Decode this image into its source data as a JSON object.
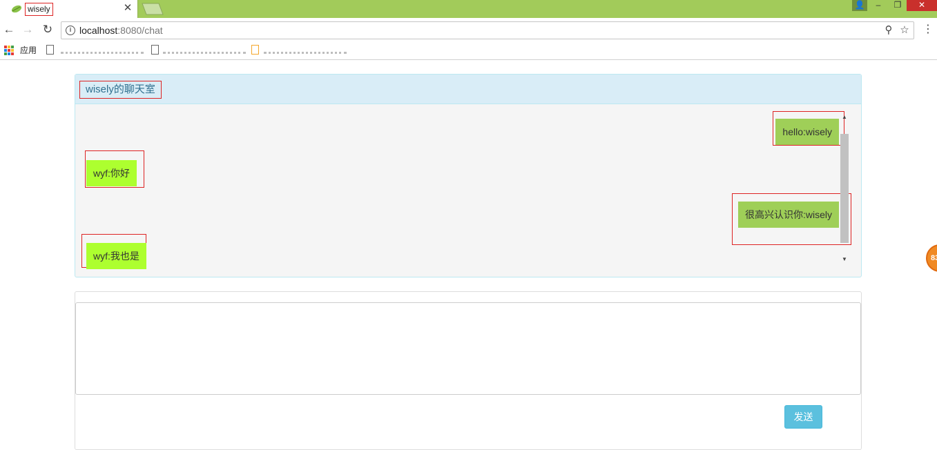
{
  "browser": {
    "tab_title": "wisely",
    "tab_close": "✕",
    "window_controls": {
      "user": "👤",
      "minimize": "–",
      "maximize": "❐",
      "close": "✕"
    },
    "url_host": "localhost",
    "url_rest": ":8080/chat",
    "icons": {
      "back": "arrow-left-icon",
      "forward": "arrow-right-icon",
      "reload": "reload-icon",
      "info": "info-icon",
      "pin": "pin-icon",
      "star": "star-icon",
      "menu": "menu-icon"
    },
    "bookmarks": {
      "apps_label": "应用"
    }
  },
  "chat": {
    "title": "wisely的聊天室",
    "messages": [
      {
        "text": "hello:wisely",
        "side": "right",
        "color": "#9fcf58"
      },
      {
        "text": "wyf:你好",
        "side": "left",
        "color": "#adff2f"
      },
      {
        "text": "很高兴认识你:wisely",
        "side": "right",
        "color": "#9fcf58"
      },
      {
        "text": "wyf:我也是",
        "side": "left",
        "color": "#adff2f"
      }
    ]
  },
  "composer": {
    "input_value": "",
    "send_label": "发送"
  },
  "side_badge": {
    "text": "83"
  },
  "colors": {
    "tabstrip": "#a2cb5a",
    "panel_heading": "#d9edf7",
    "panel_title": "#31708f",
    "send_button": "#5bc0de",
    "annotation": "#dd2222"
  }
}
